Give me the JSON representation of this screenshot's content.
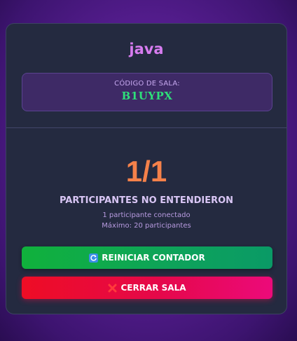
{
  "room": {
    "title": "java",
    "code_label": "CÓDIGO DE SALA:",
    "code": "B1UYPX"
  },
  "stats": {
    "count": "1/1",
    "count_label": "PARTICIPANTES NO ENTENDIERON",
    "connected": "1 participante conectado",
    "max": "Máximo: 20 participantes"
  },
  "actions": {
    "reset_label": "REINICIAR CONTADOR",
    "reset_icon": "refresh-icon",
    "close_label": "CERRAR SALA",
    "close_icon": "close-icon"
  },
  "colors": {
    "title": "#d77cf0",
    "code": "#2ee07a",
    "count": "#f5814a",
    "reset_button": "#10b13c",
    "close_button": "#ee0d25"
  }
}
